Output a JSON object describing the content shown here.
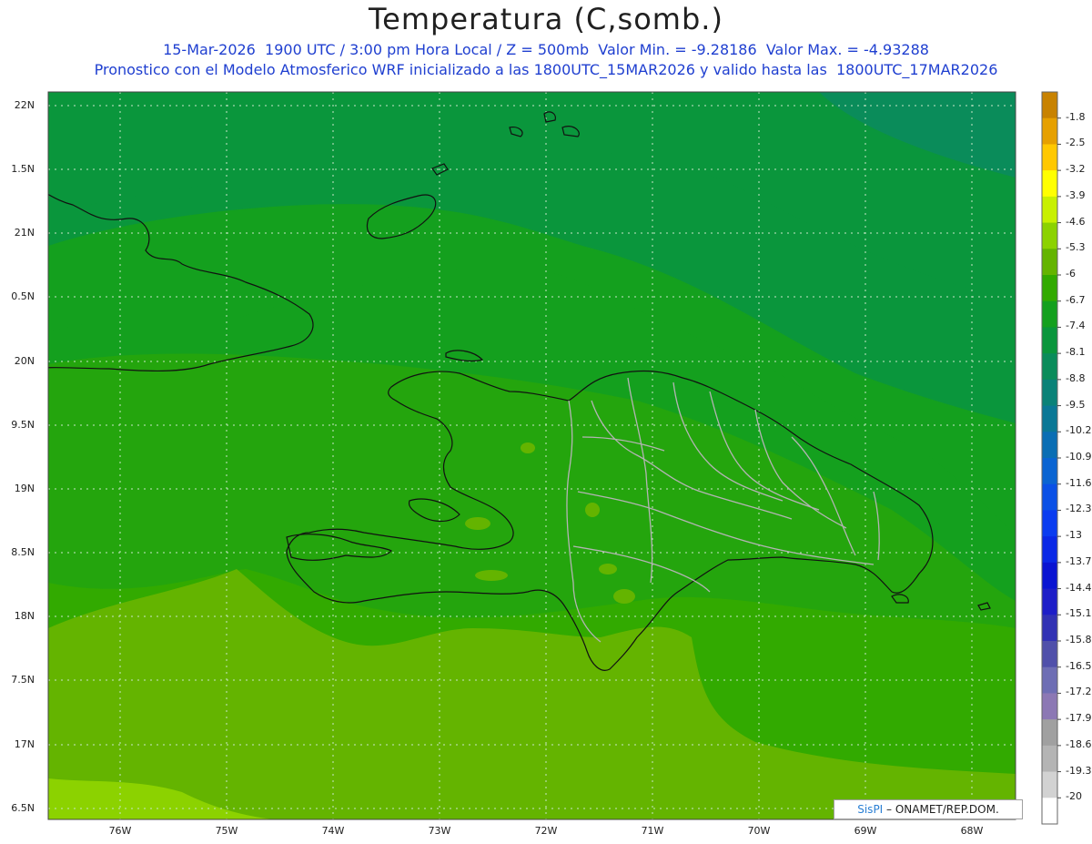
{
  "header": {
    "title": "Temperatura (C,somb.)",
    "line1": "15-Mar-2026  1900 UTC / 3:00 pm Hora Local / Z = 500mb  Valor Min. = -9.28186  Valor Max. = -4.93288",
    "line2": "Pronostico con el Modelo Atmosferico WRF inicializado a las 1800UTC_15MAR2026 y valido hasta las  1800UTC_17MAR2026"
  },
  "axes": {
    "lat_labels": [
      "22N",
      "1.5N",
      "21N",
      "0.5N",
      "20N",
      "9.5N",
      "19N",
      "8.5N",
      "18N",
      "7.5N",
      "17N",
      "6.5N"
    ],
    "lon_labels": [
      "76W",
      "75W",
      "74W",
      "73W",
      "72W",
      "71W",
      "70W",
      "69W",
      "68W"
    ]
  },
  "colorbar": {
    "labels": [
      "-1.8",
      "-2.5",
      "-3.2",
      "-3.9",
      "-4.6",
      "-5.3",
      "-6",
      "-6.7",
      "-7.4",
      "-8.1",
      "-8.8",
      "-9.5",
      "-10.2",
      "-10.9",
      "-11.6",
      "-12.3",
      "-13",
      "-13.7",
      "-14.4",
      "-15.1",
      "-15.8",
      "-16.5",
      "-17.2",
      "-17.9",
      "-18.6",
      "-19.3",
      "-20"
    ],
    "colors": [
      "#c88200",
      "#e6a000",
      "#ffc800",
      "#ffff00",
      "#c8f000",
      "#8cd200",
      "#64b400",
      "#32aa00",
      "#14a01e",
      "#0a963c",
      "#0a8c5a",
      "#0a8278",
      "#0a7896",
      "#0a6eb4",
      "#0a64d2",
      "#0a50e6",
      "#0a3cf0",
      "#0a28e6",
      "#0a14d2",
      "#1e1ec8",
      "#3232b4",
      "#5050aa",
      "#6e6eb4",
      "#8c78b4",
      "#a0a0a0",
      "#b4b4b4",
      "#d2d2d2",
      "#ffffff"
    ]
  },
  "credit": {
    "logo": "SisPI",
    "text": "– ONAMET/REP.DOM."
  }
}
